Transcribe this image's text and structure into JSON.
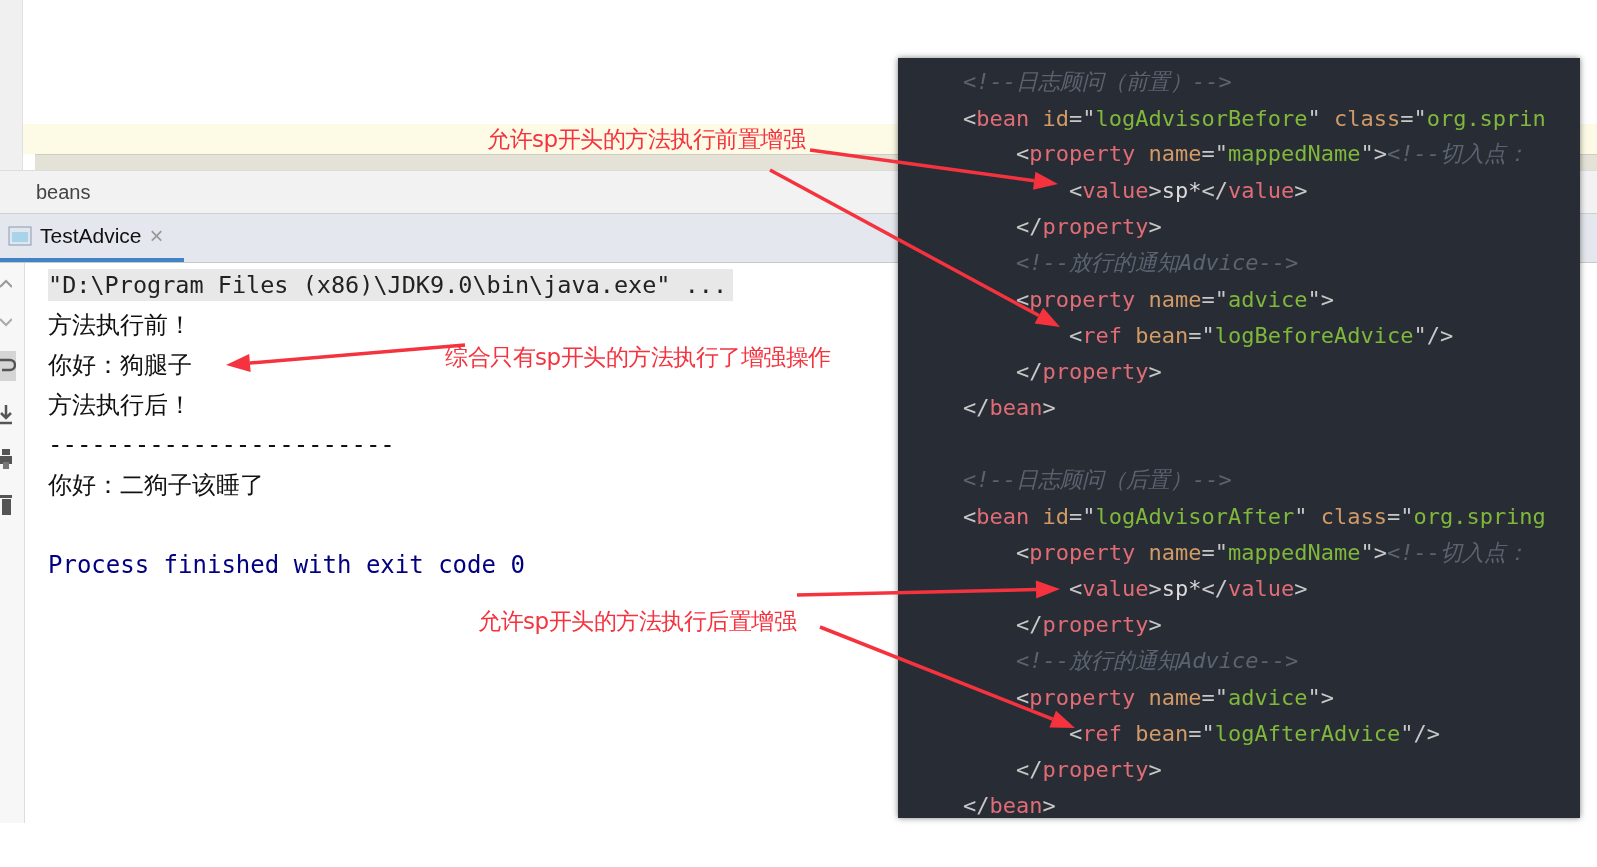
{
  "breadcrumb": "beans",
  "tabs": [
    {
      "label": "TestAdvice",
      "selected": true,
      "close": "×"
    }
  ],
  "console": [
    {
      "kind": "command",
      "text": "\"D:\\Program Files (x86)\\JDK9.0\\bin\\java.exe\" ..."
    },
    {
      "kind": "output",
      "text": "方法执行前！"
    },
    {
      "kind": "output",
      "text": "你好：狗腿子"
    },
    {
      "kind": "output",
      "text": "方法执行后！"
    },
    {
      "kind": "output",
      "text": "------------------------"
    },
    {
      "kind": "output",
      "text": "你好：二狗子该睡了"
    },
    {
      "kind": "blank"
    },
    {
      "kind": "exit",
      "text": "Process finished with exit code 0"
    }
  ],
  "code": [
    {
      "kind": "code",
      "tokens": [
        {
          "kind": "comment",
          "text": "<!--日志顾问（前置）-->"
        }
      ]
    },
    {
      "kind": "code",
      "tokens": [
        {
          "kind": "punct",
          "text": "<"
        },
        {
          "kind": "tag",
          "text": "bean "
        },
        {
          "kind": "attr",
          "text": "id"
        },
        {
          "kind": "punct",
          "text": "=\""
        },
        {
          "kind": "string",
          "text": "logAdvisorBefore"
        },
        {
          "kind": "punct",
          "text": "\" "
        },
        {
          "kind": "attr",
          "text": "class"
        },
        {
          "kind": "punct",
          "text": "=\""
        },
        {
          "kind": "string",
          "text": "org.sprin"
        }
      ],
      "children": [
        {
          "kind": "code",
          "tokens": [
            {
              "kind": "punct",
              "text": "<"
            },
            {
              "kind": "tag",
              "text": "property "
            },
            {
              "kind": "attr",
              "text": "name"
            },
            {
              "kind": "punct",
              "text": "=\""
            },
            {
              "kind": "string",
              "text": "mappedName"
            },
            {
              "kind": "punct",
              "text": "\">"
            },
            {
              "kind": "comment",
              "text": "<!--切入点："
            }
          ],
          "children": [
            {
              "kind": "code",
              "tokens": [
                {
                  "kind": "punct",
                  "text": "<"
                },
                {
                  "kind": "tag",
                  "text": "value"
                },
                {
                  "kind": "punct",
                  "text": ">"
                },
                {
                  "kind": "text",
                  "text": "sp*"
                },
                {
                  "kind": "punct",
                  "text": "</"
                },
                {
                  "kind": "tag",
                  "text": "value"
                },
                {
                  "kind": "punct",
                  "text": ">"
                }
              ]
            }
          ]
        },
        {
          "kind": "code",
          "tokens": [
            {
              "kind": "punct",
              "text": "</"
            },
            {
              "kind": "tag",
              "text": "property"
            },
            {
              "kind": "punct",
              "text": ">"
            }
          ]
        },
        {
          "kind": "code",
          "tokens": [
            {
              "kind": "comment",
              "text": "<!--放行的通知Advice-->"
            }
          ]
        },
        {
          "kind": "code",
          "tokens": [
            {
              "kind": "punct",
              "text": "<"
            },
            {
              "kind": "tag",
              "text": "property "
            },
            {
              "kind": "attr",
              "text": "name"
            },
            {
              "kind": "punct",
              "text": "=\""
            },
            {
              "kind": "string",
              "text": "advice"
            },
            {
              "kind": "punct",
              "text": "\">"
            }
          ],
          "children": [
            {
              "kind": "code",
              "tokens": [
                {
                  "kind": "punct",
                  "text": "<"
                },
                {
                  "kind": "tag",
                  "text": "ref "
                },
                {
                  "kind": "attr",
                  "text": "bean"
                },
                {
                  "kind": "punct",
                  "text": "=\""
                },
                {
                  "kind": "string",
                  "text": "logBeforeAdvice"
                },
                {
                  "kind": "punct",
                  "text": "\"/>"
                }
              ]
            }
          ]
        },
        {
          "kind": "code",
          "tokens": [
            {
              "kind": "punct",
              "text": "</"
            },
            {
              "kind": "tag",
              "text": "property"
            },
            {
              "kind": "punct",
              "text": ">"
            }
          ]
        }
      ]
    },
    {
      "kind": "code",
      "tokens": [
        {
          "kind": "punct",
          "text": "</"
        },
        {
          "kind": "tag",
          "text": "bean"
        },
        {
          "kind": "punct",
          "text": ">"
        }
      ]
    },
    {
      "kind": "blank"
    },
    {
      "kind": "code",
      "tokens": [
        {
          "kind": "comment",
          "text": "<!--日志顾问（后置）-->"
        }
      ]
    },
    {
      "kind": "code",
      "tokens": [
        {
          "kind": "punct",
          "text": "<"
        },
        {
          "kind": "tag",
          "text": "bean "
        },
        {
          "kind": "attr",
          "text": "id"
        },
        {
          "kind": "punct",
          "text": "=\""
        },
        {
          "kind": "string",
          "text": "logAdvisorAfter"
        },
        {
          "kind": "punct",
          "text": "\" "
        },
        {
          "kind": "attr",
          "text": "class"
        },
        {
          "kind": "punct",
          "text": "=\""
        },
        {
          "kind": "string",
          "text": "org.spring"
        }
      ],
      "children": [
        {
          "kind": "code",
          "tokens": [
            {
              "kind": "punct",
              "text": "<"
            },
            {
              "kind": "tag",
              "text": "property "
            },
            {
              "kind": "attr",
              "text": "name"
            },
            {
              "kind": "punct",
              "text": "=\""
            },
            {
              "kind": "string",
              "text": "mappedName"
            },
            {
              "kind": "punct",
              "text": "\">"
            },
            {
              "kind": "comment",
              "text": "<!--切入点："
            }
          ],
          "children": [
            {
              "kind": "code",
              "tokens": [
                {
                  "kind": "punct",
                  "text": "<"
                },
                {
                  "kind": "tag",
                  "text": "value"
                },
                {
                  "kind": "punct",
                  "text": ">"
                },
                {
                  "kind": "text",
                  "text": "sp*"
                },
                {
                  "kind": "punct",
                  "text": "</"
                },
                {
                  "kind": "tag",
                  "text": "value"
                },
                {
                  "kind": "punct",
                  "text": ">"
                }
              ]
            }
          ]
        },
        {
          "kind": "code",
          "tokens": [
            {
              "kind": "punct",
              "text": "</"
            },
            {
              "kind": "tag",
              "text": "property"
            },
            {
              "kind": "punct",
              "text": ">"
            }
          ]
        },
        {
          "kind": "code",
          "tokens": [
            {
              "kind": "comment",
              "text": "<!--放行的通知Advice-->"
            }
          ]
        },
        {
          "kind": "code",
          "tokens": [
            {
              "kind": "punct",
              "text": "<"
            },
            {
              "kind": "tag",
              "text": "property "
            },
            {
              "kind": "attr",
              "text": "name"
            },
            {
              "kind": "punct",
              "text": "=\""
            },
            {
              "kind": "string",
              "text": "advice"
            },
            {
              "kind": "punct",
              "text": "\">"
            }
          ],
          "children": [
            {
              "kind": "code",
              "tokens": [
                {
                  "kind": "punct",
                  "text": "<"
                },
                {
                  "kind": "tag",
                  "text": "ref "
                },
                {
                  "kind": "attr",
                  "text": "bean"
                },
                {
                  "kind": "punct",
                  "text": "=\""
                },
                {
                  "kind": "string",
                  "text": "logAfterAdvice"
                },
                {
                  "kind": "punct",
                  "text": "\"/>"
                }
              ]
            }
          ]
        },
        {
          "kind": "code",
          "tokens": [
            {
              "kind": "punct",
              "text": "</"
            },
            {
              "kind": "tag",
              "text": "property"
            },
            {
              "kind": "punct",
              "text": ">"
            }
          ]
        }
      ]
    },
    {
      "kind": "code",
      "tokens": [
        {
          "kind": "punct",
          "text": "</"
        },
        {
          "kind": "tag",
          "text": "bean"
        },
        {
          "kind": "punct",
          "text": ">"
        }
      ]
    }
  ],
  "annotations": [
    {
      "text": "允许sp开头的方法执行前置增强"
    },
    {
      "text": "综合只有sp开头的方法执行了增强操作"
    },
    {
      "text": "允许sp开头的方法执行后置增强"
    }
  ]
}
